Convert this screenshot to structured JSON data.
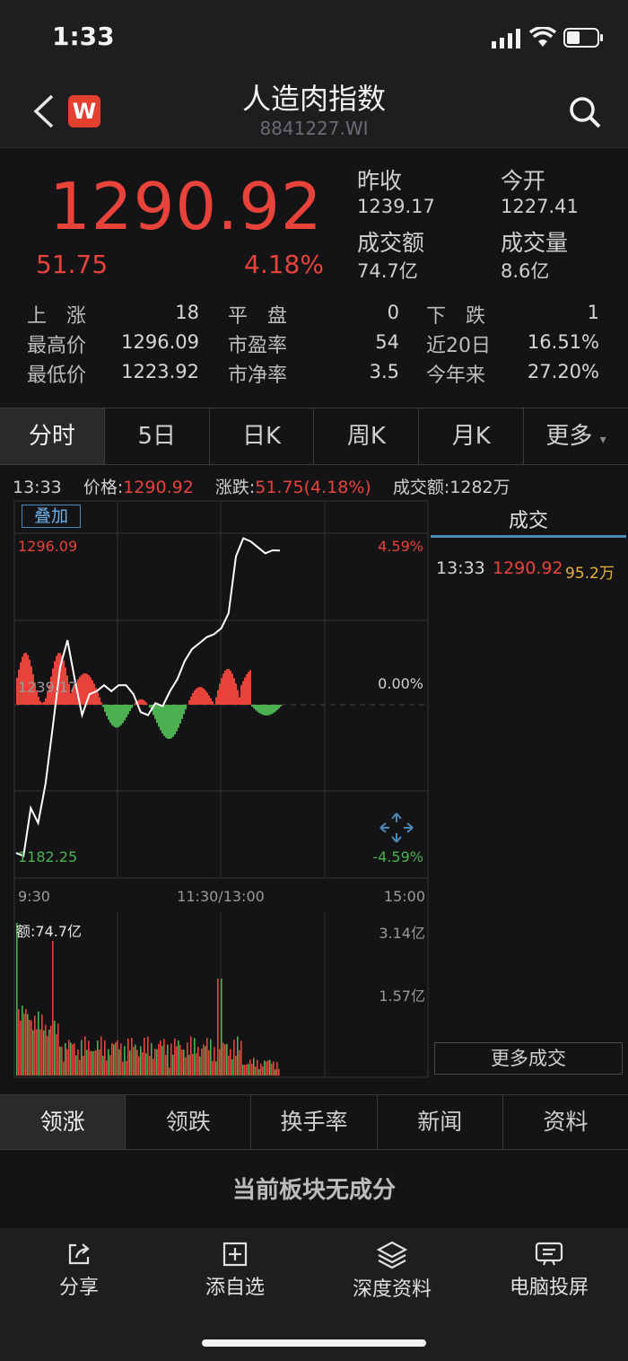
{
  "status": {
    "time": "1:33"
  },
  "header": {
    "title": "人造肉指数",
    "code": "8841227.WI",
    "logo": "W"
  },
  "quote": {
    "price": "1290.92",
    "change": "51.75",
    "change_pct": "4.18%",
    "prev_close_label": "昨收",
    "prev_close": "1239.17",
    "open_label": "今开",
    "open": "1227.41",
    "turnover_label": "成交额",
    "turnover": "74.7亿",
    "volume_label": "成交量",
    "volume": "8.6亿"
  },
  "stats": [
    {
      "l1": "上　涨",
      "v1": "18",
      "l2": "平　盘",
      "v2": "0",
      "l3": "下　跌",
      "v3": "1"
    },
    {
      "l1": "最高价",
      "v1": "1296.09",
      "l2": "市盈率",
      "v2": "54",
      "l3": "近20日",
      "v3": "16.51%"
    },
    {
      "l1": "最低价",
      "v1": "1223.92",
      "l2": "市净率",
      "v2": "3.5",
      "l3": "今年来",
      "v3": "27.20%"
    }
  ],
  "period_tabs": [
    "分时",
    "5日",
    "日K",
    "周K",
    "月K",
    "更多"
  ],
  "info": {
    "time": "13:33",
    "price_label": "价格:",
    "price": "1290.92",
    "chg_label": "涨跌:",
    "chg": "51.75(4.18%)",
    "amt_label": "成交额:",
    "amt": "1282万"
  },
  "chart": {
    "overlay_label": "叠加",
    "y_high": "1296.09",
    "y_mid": "1239.17",
    "y_low": "1182.25",
    "pct_high": "4.59%",
    "pct_mid": "0.00%",
    "pct_low": "-4.59%",
    "x_start": "9:30",
    "x_mid": "11:30/13:00",
    "x_end": "15:00",
    "vol_label": "额:74.7亿",
    "vol_high": "3.14亿",
    "vol_mid": "1.57亿"
  },
  "chart_data": {
    "type": "line",
    "x_range": [
      "9:30",
      "15:00"
    ],
    "ylim": [
      1182.25,
      1296.09
    ],
    "price_line": [
      1190,
      1189,
      1205,
      1200,
      1213,
      1232,
      1252,
      1261,
      1248,
      1236,
      1243,
      1244,
      1246,
      1244,
      1246,
      1246,
      1243,
      1237,
      1236,
      1240,
      1239,
      1244,
      1248,
      1254,
      1258,
      1260,
      1262,
      1263,
      1265,
      1270,
      1289,
      1295,
      1294,
      1292,
      1290,
      1291,
      1290.92
    ],
    "volume_max": "3.14亿"
  },
  "trades": {
    "title": "成交",
    "rows": [
      {
        "time": "13:33",
        "price": "1290.92",
        "vol": "95.2万"
      }
    ],
    "more_label": "更多成交"
  },
  "rank_tabs": [
    "领涨",
    "领跌",
    "换手率",
    "新闻",
    "资料"
  ],
  "empty_note": "当前板块无成分",
  "bottom_bar": [
    {
      "icon": "share-icon",
      "label": "分享"
    },
    {
      "icon": "add-watchlist-icon",
      "label": "添自选"
    },
    {
      "icon": "layers-icon",
      "label": "深度资料"
    },
    {
      "icon": "screen-cast-icon",
      "label": "电脑投屏"
    }
  ]
}
